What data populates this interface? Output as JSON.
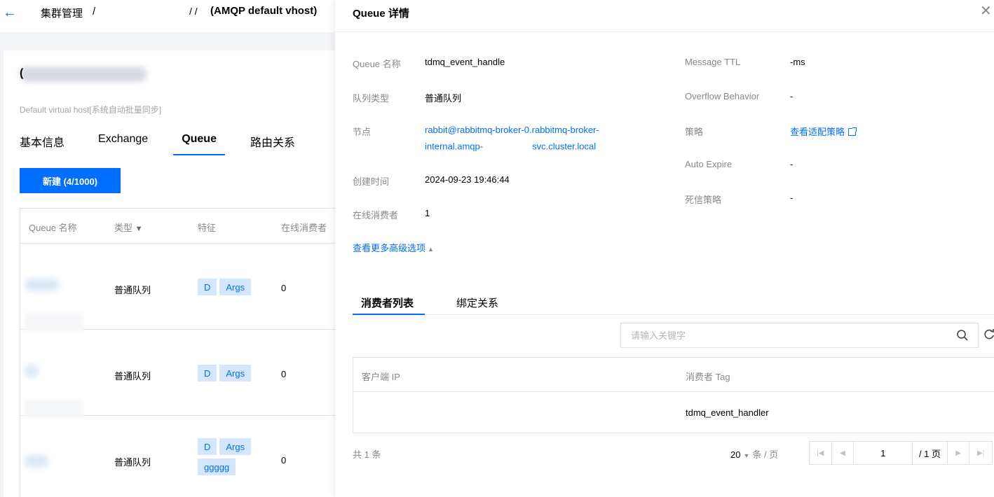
{
  "breadcrumb": {
    "root": "集群管理",
    "sep1": "/",
    "sep2": "/ /",
    "vhost": "(AMQP default vhost)"
  },
  "vhost_panel": {
    "title_mark": "(",
    "description": "Default virtual host[系统自动批量同步]",
    "tabs": [
      "基本信息",
      "Exchange",
      "Queue",
      "路由关系"
    ],
    "active_tab": "Queue",
    "new_button": "新建 (4/1000)"
  },
  "queue_table": {
    "columns": [
      "Queue 名称",
      "类型",
      "特征",
      "在线消费者"
    ],
    "type_filter_icon": "filter-icon",
    "rows": [
      {
        "type": "普通队列",
        "tags": [
          "D",
          "Args"
        ],
        "consumers": "0"
      },
      {
        "type": "普通队列",
        "tags": [
          "D",
          "Args"
        ],
        "consumers": "0"
      },
      {
        "type": "普通队列",
        "tags": [
          "D",
          "Args",
          "ggggg"
        ],
        "consumers": "0"
      }
    ]
  },
  "drawer": {
    "title": "Queue 详情",
    "close_icon": "close-icon",
    "left_fields": {
      "name_label": "Queue 名称",
      "name_value": "tdmq_event_handle",
      "type_label": "队列类型",
      "type_value": "普通队列",
      "node_label": "节点",
      "node_line1": "rabbit@rabbitmq-broker-0.rabbitmq-broker-",
      "node_line2a": "internal.amqp-",
      "node_line2b": "svc.cluster.local",
      "created_label": "创建时间",
      "created_value": "2024-09-23 19:46:44",
      "consumers_label": "在线消费者",
      "consumers_value": "1"
    },
    "right_fields": {
      "ttl_label": "Message TTL",
      "ttl_value": "-ms",
      "overflow_label": "Overflow Behavior",
      "overflow_value": "-",
      "policy_label": "策略",
      "policy_link": "查看适配策略",
      "expire_label": "Auto Expire",
      "expire_value": "-",
      "dlx_label": "死信策略",
      "dlx_value": "-"
    },
    "advanced_link": "查看更多高级选项",
    "tabs": [
      "消费者列表",
      "绑定关系"
    ],
    "active_tab": "消费者列表",
    "search_placeholder": "请输入关键字",
    "consumer_table": {
      "columns": [
        "客户端 IP",
        "消费者 Tag"
      ],
      "rows": [
        {
          "ip": "",
          "tag": "tdmq_event_handler"
        }
      ]
    },
    "pager": {
      "total": "共 1 条",
      "page_size": "20",
      "page_size_unit": "条 / 页",
      "page": "1",
      "page_total": "/ 1 页"
    }
  }
}
